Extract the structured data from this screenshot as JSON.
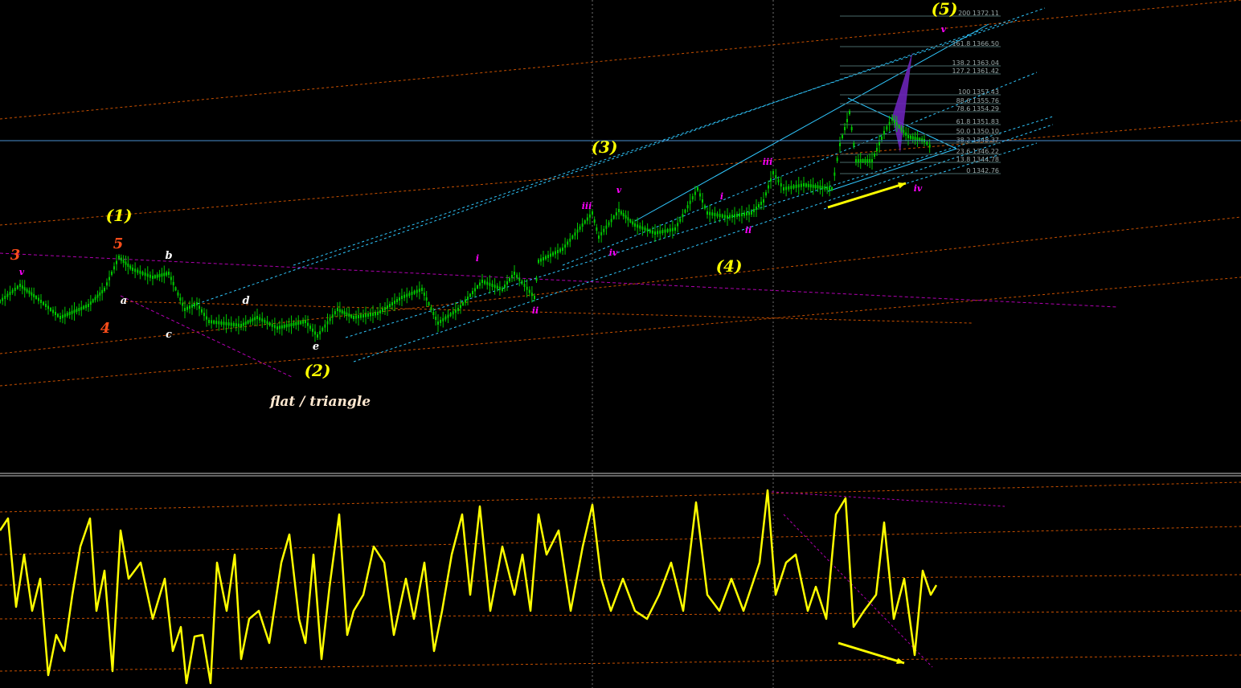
{
  "chart_data": {
    "type": "line",
    "instrument_panel": "price",
    "colors": {
      "background": "#000000",
      "candle": "#00c800",
      "oscillator": "#ffff00",
      "wave_primary": "#ffff00",
      "wave_orange": "#ff4d1a",
      "wave_white": "#ffffff",
      "wave_magenta": "#ff00ff",
      "fib": "#9aa8a8",
      "channel": "#30c8ff",
      "dashed_orange": "#c85000",
      "dashed_magenta": "#b000b0",
      "current_price_line": "#4a8fd0",
      "pattern_fill": "#6b24b8",
      "arrow": "#ffff00"
    },
    "wave_labels": {
      "primary": [
        "(1)",
        "(2)",
        "(3)",
        "(4)",
        "(5)"
      ],
      "orange": [
        "3",
        "4",
        "5"
      ],
      "white": [
        "a",
        "b",
        "c",
        "d",
        "e"
      ],
      "magenta": [
        "v",
        "i",
        "ii",
        "iii",
        "iv",
        "v",
        "i",
        "ii",
        "iii",
        "iv",
        "v"
      ]
    },
    "annotation": "flat / triangle",
    "fib_levels": [
      {
        "ratio": "200",
        "price": "1372.11"
      },
      {
        "ratio": "161.8",
        "price": "1366.50"
      },
      {
        "ratio": "138.2",
        "price": "1363.04"
      },
      {
        "ratio": "127.2",
        "price": "1361.42"
      },
      {
        "ratio": "100",
        "price": "1357.43"
      },
      {
        "ratio": "88.6",
        "price": "1355.76"
      },
      {
        "ratio": "78.6",
        "price": "1354.29"
      },
      {
        "ratio": "61.8",
        "price": "1351.83"
      },
      {
        "ratio": "50.0",
        "price": "1350.10"
      },
      {
        "ratio": "38.2",
        "price": "1348.37"
      },
      {
        "ratio": "23.6",
        "price": "1346.22"
      },
      {
        "ratio": "13.8",
        "price": "1344.78"
      },
      {
        "ratio": "0",
        "price": "1342.76"
      }
    ],
    "grid": false,
    "legend": "none"
  }
}
